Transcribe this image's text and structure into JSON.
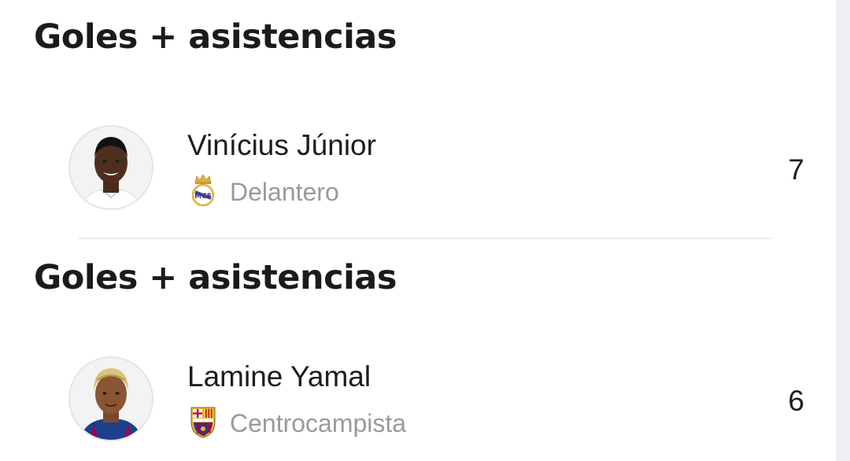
{
  "cards": [
    {
      "title": "Goles + asistencias",
      "player": {
        "name": "Vinícius Júnior",
        "position": "Delantero",
        "club_icon": "real-madrid-crest-icon",
        "value": "7"
      }
    },
    {
      "title": "Goles + asistencias",
      "player": {
        "name": "Lamine Yamal",
        "position": "Centrocampista",
        "club_icon": "fc-barcelona-crest-icon",
        "value": "6"
      }
    }
  ],
  "colors": {
    "title": "#1b1b1b",
    "name": "#1d1d1d",
    "position": "#9a9a9a",
    "divider": "#eceae4",
    "barca_blue": "#1d3f8c",
    "barca_red": "#a50044",
    "madrid_gold": "#e2b13c"
  }
}
